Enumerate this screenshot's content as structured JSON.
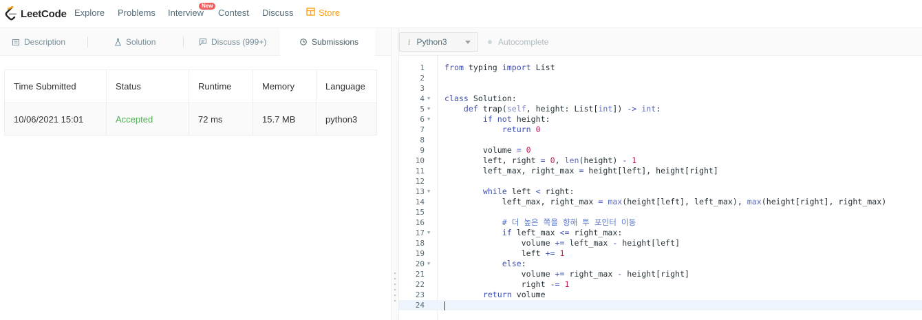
{
  "app": {
    "brand": "LeetCode"
  },
  "nav": {
    "items": [
      {
        "label": "Explore"
      },
      {
        "label": "Problems"
      },
      {
        "label": "Interview"
      },
      {
        "label": "Contest"
      },
      {
        "label": "Discuss"
      }
    ],
    "badge": "New",
    "store": "Store"
  },
  "tabs": [
    {
      "label": "Description",
      "icon": "description-icon"
    },
    {
      "label": "Solution",
      "icon": "flask-icon"
    },
    {
      "label": "Discuss (999+)",
      "icon": "discuss-icon"
    },
    {
      "label": "Submissions",
      "icon": "clock-icon",
      "active": true
    }
  ],
  "submissions": {
    "headers": [
      "Time Submitted",
      "Status",
      "Runtime",
      "Memory",
      "Language"
    ],
    "rows": [
      {
        "time": "10/06/2021 15:01",
        "status": "Accepted",
        "runtime": "72 ms",
        "memory": "15.7 MB",
        "language": "python3"
      }
    ]
  },
  "editor": {
    "language": "Python3",
    "autocomplete": "Autocomplete",
    "current_line": 24,
    "lines": [
      "from typing import List",
      "",
      "",
      "class Solution:",
      "    def trap(self, height: List[int]) -> int:",
      "        if not height:",
      "            return 0",
      "",
      "        volume = 0",
      "        left, right = 0, len(height) - 1",
      "        left_max, right_max = height[left], height[right]",
      "",
      "        while left < right:",
      "            left_max, right_max = max(height[left], left_max), max(height[right], right_max)",
      "",
      "            # 더 높은 쪽을 향해 투 포인터 이동",
      "            if left_max <= right_max:",
      "                volume += left_max - height[left]",
      "                left += 1",
      "            else:",
      "                volume += right_max - height[right]",
      "                right -= 1",
      "        return volume",
      ""
    ],
    "fold_lines": [
      4,
      5,
      6,
      13,
      17,
      20
    ]
  },
  "colors": {
    "accent": "#ffa116",
    "accepted": "#4caf50",
    "badge": "#f25d5d"
  }
}
